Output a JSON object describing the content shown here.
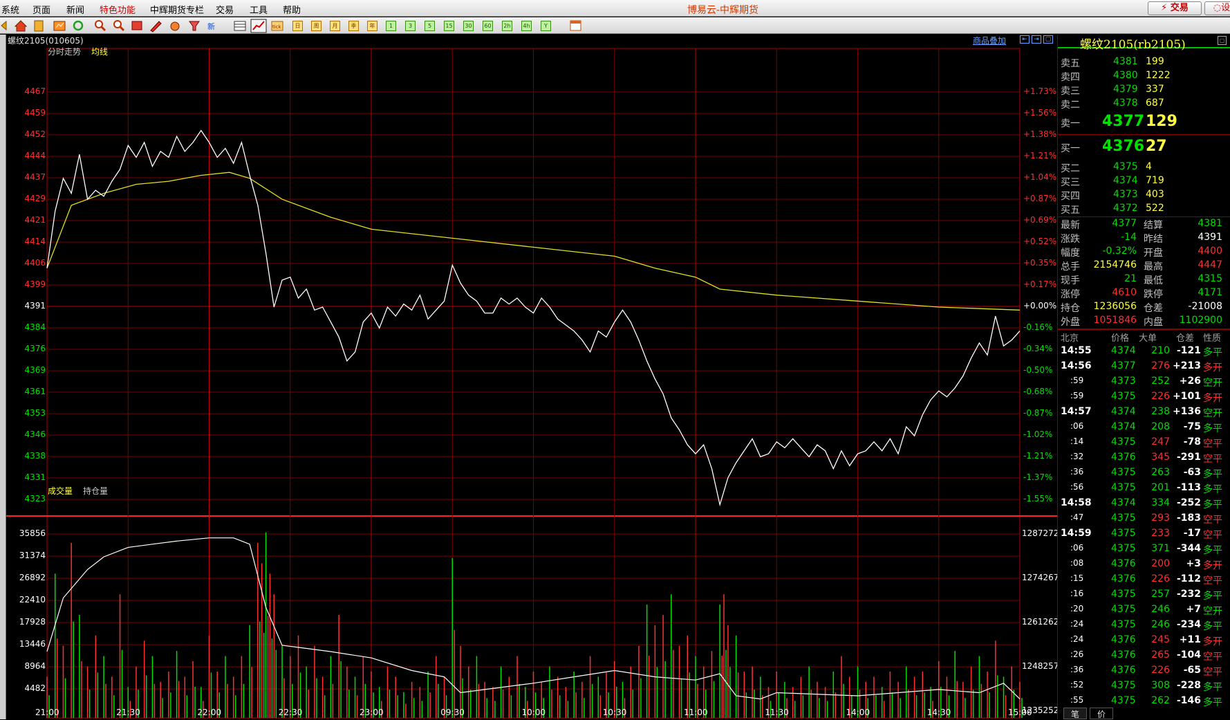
{
  "app_title": "博易云-中辉期货",
  "menu": [
    "系统",
    "页面",
    "新闻",
    "特色功能",
    "中辉期货专栏",
    "交易",
    "工具",
    "帮助"
  ],
  "trade_button": "交易",
  "settings_button": "设",
  "toolbar_icons": [
    "home-icon",
    "notebook-icon",
    "chart-icon",
    "refresh-icon",
    "zoom-in-icon",
    "zoom-out-icon",
    "window-icon",
    "pen-icon",
    "palette-icon",
    "filter-icon",
    "new-icon",
    "table-icon",
    "intraday-icon",
    "tick-icon"
  ],
  "toolbar_periods": [
    "日",
    "周",
    "月",
    "季",
    "年",
    "1",
    "3",
    "5",
    "15",
    "30",
    "60",
    "2h",
    "4h",
    "Y"
  ],
  "instrument_label": "螺纹2105(010605)",
  "overlay_link": "商品叠加",
  "panel_titles": {
    "intraday": "分时走势",
    "avg": "均线",
    "volume": "成交量",
    "oi": "持仓量"
  },
  "chart_data": {
    "type": "line",
    "price_ticks": [
      "4467",
      "4459",
      "4452",
      "4444",
      "4437",
      "4429",
      "4421",
      "4414",
      "4406",
      "4399",
      "4391",
      "4384",
      "4376",
      "4369",
      "4361",
      "4353",
      "4346",
      "4338",
      "4331",
      "4323"
    ],
    "pct_ticks": [
      "+1.73%",
      "+1.56%",
      "+1.38%",
      "+1.21%",
      "+1.04%",
      "+0.87%",
      "+0.69%",
      "+0.52%",
      "+0.35%",
      "+0.17%",
      "+0.00%",
      "-0.16%",
      "-0.34%",
      "-0.50%",
      "-0.68%",
      "-0.87%",
      "-1.02%",
      "-1.21%",
      "-1.37%",
      "-1.55%"
    ],
    "prev_settle": 4391,
    "y_range": [
      4316,
      4471
    ],
    "volume_ticks": [
      "35856",
      "31374",
      "26892",
      "22410",
      "17928",
      "13446",
      "8964",
      "4482"
    ],
    "oi_ticks": [
      "1287272",
      "1274267",
      "1261262",
      "1248257",
      "1235252"
    ],
    "time_labels": [
      "21:00",
      "21:30",
      "22:00",
      "22:30",
      "23:00",
      "09:30",
      "10:00",
      "10:30",
      "11:00",
      "11:30",
      "14:00",
      "14:30",
      "15:00"
    ],
    "price_series": [
      [
        0,
        4399
      ],
      [
        2,
        4418
      ],
      [
        4,
        4429
      ],
      [
        6,
        4424
      ],
      [
        8,
        4437
      ],
      [
        10,
        4422
      ],
      [
        12,
        4425
      ],
      [
        14,
        4423
      ],
      [
        16,
        4428
      ],
      [
        18,
        4432
      ],
      [
        20,
        4440
      ],
      [
        22,
        4436
      ],
      [
        24,
        4441
      ],
      [
        26,
        4433
      ],
      [
        28,
        4438
      ],
      [
        30,
        4436
      ],
      [
        32,
        4443
      ],
      [
        34,
        4438
      ],
      [
        36,
        4441
      ],
      [
        38,
        4445
      ],
      [
        40,
        4441
      ],
      [
        42,
        4436
      ],
      [
        44,
        4439
      ],
      [
        46,
        4434
      ],
      [
        48,
        4441
      ],
      [
        50,
        4430
      ],
      [
        52,
        4420
      ],
      [
        54,
        4404
      ],
      [
        56,
        4386
      ],
      [
        58,
        4395
      ],
      [
        60,
        4396
      ],
      [
        62,
        4389
      ],
      [
        64,
        4392
      ],
      [
        66,
        4385
      ],
      [
        68,
        4386
      ],
      [
        70,
        4381
      ],
      [
        72,
        4376
      ],
      [
        74,
        4368
      ],
      [
        76,
        4371
      ],
      [
        78,
        4381
      ],
      [
        80,
        4384
      ],
      [
        82,
        4379
      ],
      [
        84,
        4386
      ],
      [
        86,
        4383
      ],
      [
        88,
        4387
      ],
      [
        90,
        4385
      ],
      [
        92,
        4390
      ],
      [
        94,
        4382
      ],
      [
        96,
        4385
      ],
      [
        98,
        4388
      ],
      [
        100,
        4400
      ],
      [
        102,
        4394
      ],
      [
        104,
        4390
      ],
      [
        106,
        4388
      ],
      [
        108,
        4384
      ],
      [
        110,
        4384
      ],
      [
        112,
        4389
      ],
      [
        114,
        4387
      ],
      [
        116,
        4389
      ],
      [
        118,
        4386
      ],
      [
        120,
        4384
      ],
      [
        122,
        4389
      ],
      [
        124,
        4386
      ],
      [
        126,
        4382
      ],
      [
        128,
        4380
      ],
      [
        130,
        4378
      ],
      [
        132,
        4375
      ],
      [
        134,
        4371
      ],
      [
        136,
        4378
      ],
      [
        138,
        4376
      ],
      [
        140,
        4381
      ],
      [
        142,
        4385
      ],
      [
        144,
        4381
      ],
      [
        146,
        4375
      ],
      [
        148,
        4368
      ],
      [
        150,
        4362
      ],
      [
        152,
        4357
      ],
      [
        154,
        4349
      ],
      [
        156,
        4345
      ],
      [
        158,
        4340
      ],
      [
        160,
        4337
      ],
      [
        162,
        4340
      ],
      [
        164,
        4332
      ],
      [
        166,
        4320
      ],
      [
        168,
        4329
      ],
      [
        170,
        4334
      ],
      [
        172,
        4338
      ],
      [
        174,
        4342
      ],
      [
        176,
        4336
      ],
      [
        178,
        4337
      ],
      [
        180,
        4341
      ],
      [
        182,
        4339
      ],
      [
        184,
        4342
      ],
      [
        186,
        4339
      ],
      [
        188,
        4336
      ],
      [
        190,
        4340
      ],
      [
        192,
        4338
      ],
      [
        194,
        4332
      ],
      [
        196,
        4338
      ],
      [
        198,
        4333
      ],
      [
        200,
        4337
      ],
      [
        202,
        4338
      ],
      [
        204,
        4341
      ],
      [
        206,
        4338
      ],
      [
        208,
        4342
      ],
      [
        210,
        4337
      ],
      [
        212,
        4346
      ],
      [
        214,
        4343
      ],
      [
        216,
        4350
      ],
      [
        218,
        4355
      ],
      [
        220,
        4358
      ],
      [
        222,
        4356
      ],
      [
        224,
        4359
      ],
      [
        226,
        4363
      ],
      [
        228,
        4369
      ],
      [
        230,
        4374
      ],
      [
        232,
        4370
      ],
      [
        234,
        4383
      ],
      [
        236,
        4373
      ],
      [
        238,
        4375
      ],
      [
        240,
        4378
      ]
    ],
    "avg_series": [
      [
        0,
        4399
      ],
      [
        6,
        4420
      ],
      [
        14,
        4424
      ],
      [
        22,
        4427
      ],
      [
        30,
        4428
      ],
      [
        38,
        4430
      ],
      [
        45,
        4431
      ],
      [
        50,
        4429
      ],
      [
        58,
        4422
      ],
      [
        64,
        4419
      ],
      [
        70,
        4416
      ],
      [
        80,
        4412
      ],
      [
        100,
        4409
      ],
      [
        120,
        4406
      ],
      [
        140,
        4403
      ],
      [
        150,
        4399
      ],
      [
        160,
        4396
      ],
      [
        166,
        4392
      ],
      [
        180,
        4390
      ],
      [
        200,
        4388
      ],
      [
        220,
        4386
      ],
      [
        240,
        4385
      ]
    ],
    "volume_series": [
      [
        0,
        8
      ],
      [
        2,
        28
      ],
      [
        4,
        14
      ],
      [
        6,
        34
      ],
      [
        8,
        20
      ],
      [
        10,
        10
      ],
      [
        12,
        16
      ],
      [
        14,
        12
      ],
      [
        16,
        8
      ],
      [
        18,
        24
      ],
      [
        20,
        6
      ],
      [
        22,
        10
      ],
      [
        24,
        15
      ],
      [
        26,
        12
      ],
      [
        28,
        7
      ],
      [
        30,
        9
      ],
      [
        32,
        13
      ],
      [
        34,
        8
      ],
      [
        36,
        11
      ],
      [
        38,
        6
      ],
      [
        40,
        16
      ],
      [
        42,
        9
      ],
      [
        44,
        12
      ],
      [
        46,
        8
      ],
      [
        48,
        12
      ],
      [
        50,
        18
      ],
      [
        52,
        34
      ],
      [
        53,
        30
      ],
      [
        54,
        36
      ],
      [
        55,
        28
      ],
      [
        56,
        24
      ],
      [
        58,
        14
      ],
      [
        60,
        12
      ],
      [
        62,
        16
      ],
      [
        64,
        10
      ],
      [
        66,
        14
      ],
      [
        68,
        8
      ],
      [
        70,
        12
      ],
      [
        72,
        20
      ],
      [
        74,
        10
      ],
      [
        76,
        8
      ],
      [
        78,
        12
      ],
      [
        80,
        9
      ],
      [
        82,
        6
      ],
      [
        84,
        10
      ],
      [
        86,
        8
      ],
      [
        88,
        5
      ],
      [
        90,
        7
      ],
      [
        92,
        6
      ],
      [
        94,
        9
      ],
      [
        96,
        12
      ],
      [
        98,
        8
      ],
      [
        100,
        31
      ],
      [
        102,
        14
      ],
      [
        104,
        10
      ],
      [
        106,
        12
      ],
      [
        108,
        7
      ],
      [
        110,
        6
      ],
      [
        112,
        10
      ],
      [
        114,
        8
      ],
      [
        116,
        12
      ],
      [
        118,
        6
      ],
      [
        120,
        9
      ],
      [
        122,
        7
      ],
      [
        124,
        10
      ],
      [
        126,
        8
      ],
      [
        128,
        6
      ],
      [
        130,
        9
      ],
      [
        132,
        7
      ],
      [
        134,
        12
      ],
      [
        136,
        8
      ],
      [
        138,
        9
      ],
      [
        140,
        11
      ],
      [
        142,
        7
      ],
      [
        144,
        10
      ],
      [
        146,
        14
      ],
      [
        148,
        22
      ],
      [
        150,
        18
      ],
      [
        152,
        20
      ],
      [
        154,
        24
      ],
      [
        156,
        14
      ],
      [
        158,
        16
      ],
      [
        160,
        12
      ],
      [
        162,
        10
      ],
      [
        164,
        13
      ],
      [
        166,
        22
      ],
      [
        167,
        24
      ],
      [
        168,
        18
      ],
      [
        170,
        16
      ],
      [
        172,
        9
      ],
      [
        174,
        10
      ],
      [
        176,
        8
      ],
      [
        178,
        6
      ],
      [
        180,
        9
      ],
      [
        182,
        7
      ],
      [
        184,
        6
      ],
      [
        186,
        8
      ],
      [
        188,
        10
      ],
      [
        190,
        7
      ],
      [
        192,
        6
      ],
      [
        194,
        9
      ],
      [
        196,
        12
      ],
      [
        198,
        8
      ],
      [
        200,
        10
      ],
      [
        202,
        7
      ],
      [
        204,
        8
      ],
      [
        206,
        6
      ],
      [
        208,
        9
      ],
      [
        210,
        7
      ],
      [
        212,
        10
      ],
      [
        214,
        8
      ],
      [
        216,
        9
      ],
      [
        218,
        6
      ],
      [
        220,
        11
      ],
      [
        222,
        8
      ],
      [
        224,
        13
      ],
      [
        226,
        7
      ],
      [
        228,
        10
      ],
      [
        230,
        12
      ],
      [
        232,
        9
      ],
      [
        234,
        15
      ],
      [
        236,
        8
      ],
      [
        238,
        10
      ],
      [
        240,
        7
      ]
    ],
    "oi_series": [
      [
        0,
        1251000
      ],
      [
        4,
        1268000
      ],
      [
        10,
        1277000
      ],
      [
        14,
        1281000
      ],
      [
        20,
        1284000
      ],
      [
        26,
        1285000
      ],
      [
        32,
        1286000
      ],
      [
        40,
        1287000
      ],
      [
        46,
        1287000
      ],
      [
        50,
        1285000
      ],
      [
        54,
        1265000
      ],
      [
        58,
        1253000
      ],
      [
        64,
        1252000
      ],
      [
        70,
        1251000
      ],
      [
        80,
        1249000
      ],
      [
        90,
        1245000
      ],
      [
        98,
        1243000
      ],
      [
        102,
        1238000
      ],
      [
        108,
        1239000
      ],
      [
        120,
        1241000
      ],
      [
        130,
        1243000
      ],
      [
        140,
        1245000
      ],
      [
        150,
        1243000
      ],
      [
        160,
        1242000
      ],
      [
        166,
        1244000
      ],
      [
        170,
        1237000
      ],
      [
        176,
        1236000
      ],
      [
        180,
        1238000
      ],
      [
        200,
        1237000
      ],
      [
        220,
        1239000
      ],
      [
        230,
        1238000
      ],
      [
        236,
        1241000
      ],
      [
        240,
        1236000
      ]
    ]
  },
  "quote": {
    "title": "螺纹2105(rb2105)",
    "asks": [
      [
        "卖五",
        "4381",
        "199"
      ],
      [
        "卖四",
        "4380",
        "1222"
      ],
      [
        "卖三",
        "4379",
        "337"
      ],
      [
        "卖二",
        "4378",
        "687"
      ]
    ],
    "ask1": [
      "卖一",
      "4377",
      "129"
    ],
    "bid1": [
      "买一",
      "4376",
      "27"
    ],
    "bids": [
      [
        "买二",
        "4375",
        "4"
      ],
      [
        "买三",
        "4374",
        "719"
      ],
      [
        "买四",
        "4373",
        "403"
      ],
      [
        "买五",
        "4372",
        "522"
      ]
    ],
    "stats": [
      [
        "最新",
        "4377",
        "结算",
        "4381"
      ],
      [
        "涨跌",
        "-14",
        "昨结",
        "4391"
      ],
      [
        "幅度",
        "-0.32%",
        "开盘",
        "4400"
      ],
      [
        "总手",
        "2154746",
        "最高",
        "4447"
      ],
      [
        "现手",
        "21",
        "最低",
        "4315"
      ],
      [
        "涨停",
        "4610",
        "跌停",
        "4171"
      ],
      [
        "持仓",
        "1236056",
        "仓差",
        "-21008"
      ],
      [
        "外盘",
        "1051846",
        "内盘",
        "1102900"
      ]
    ]
  },
  "ticks_header": [
    "北京",
    "价格",
    "大单",
    "仓差",
    "性质"
  ],
  "ticks": [
    [
      "14:55",
      "4374",
      "210",
      "-121",
      "多平"
    ],
    [
      "14:56",
      "4377",
      "276",
      "+213",
      "多开"
    ],
    [
      ":59",
      "4373",
      "252",
      "+26",
      "空开"
    ],
    [
      ":59",
      "4375",
      "226",
      "+101",
      "多开"
    ],
    [
      "14:57",
      "4374",
      "238",
      "+136",
      "空开"
    ],
    [
      ":06",
      "4374",
      "208",
      "-75",
      "多平"
    ],
    [
      ":14",
      "4375",
      "247",
      "-78",
      "空平"
    ],
    [
      ":32",
      "4376",
      "345",
      "-291",
      "空平"
    ],
    [
      ":36",
      "4375",
      "263",
      "-63",
      "多平"
    ],
    [
      ":56",
      "4375",
      "201",
      "-113",
      "多平"
    ],
    [
      "14:58",
      "4374",
      "334",
      "-252",
      "多平"
    ],
    [
      ":47",
      "4375",
      "293",
      "-183",
      "空平"
    ],
    [
      "14:59",
      "4375",
      "233",
      "-17",
      "空平"
    ],
    [
      ":06",
      "4375",
      "371",
      "-344",
      "多平"
    ],
    [
      ":08",
      "4376",
      "200",
      "+3",
      "多开"
    ],
    [
      ":15",
      "4376",
      "226",
      "-112",
      "空平"
    ],
    [
      ":16",
      "4375",
      "257",
      "-232",
      "多平"
    ],
    [
      ":20",
      "4375",
      "246",
      "+7",
      "空开"
    ],
    [
      ":24",
      "4375",
      "246",
      "-234",
      "多平"
    ],
    [
      ":24",
      "4376",
      "245",
      "+11",
      "多开"
    ],
    [
      ":26",
      "4376",
      "265",
      "-104",
      "空平"
    ],
    [
      ":36",
      "4376",
      "226",
      "-65",
      "空平"
    ],
    [
      ":52",
      "4375",
      "308",
      "-228",
      "多平"
    ],
    [
      ":55",
      "4375",
      "262",
      "-146",
      "多平"
    ]
  ],
  "bottom_tabs": [
    "笔",
    "价"
  ]
}
